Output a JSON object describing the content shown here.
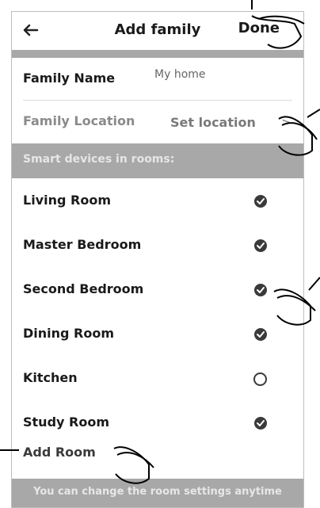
{
  "header": {
    "back_icon": "arrow-left-icon",
    "title": "Add family",
    "done_label": "Done"
  },
  "family": {
    "name_label": "Family Name",
    "name_value": "My home",
    "location_label": "Family Location",
    "location_value": "Set location",
    "location_chevron": ">"
  },
  "section": {
    "rooms_title": "Smart devices in rooms:"
  },
  "rooms": [
    {
      "name": "Living Room",
      "checked": true
    },
    {
      "name": "Master Bedroom",
      "checked": true
    },
    {
      "name": "Second Bedroom",
      "checked": true
    },
    {
      "name": "Dining Room",
      "checked": true
    },
    {
      "name": "Kitchen",
      "checked": false
    },
    {
      "name": "Study Room",
      "checked": true
    }
  ],
  "add_room_label": "Add Room",
  "footer_hint": "You can change the room settings anytime",
  "colors": {
    "band": "#a8a8a8",
    "checked": "#3a3a3a"
  }
}
